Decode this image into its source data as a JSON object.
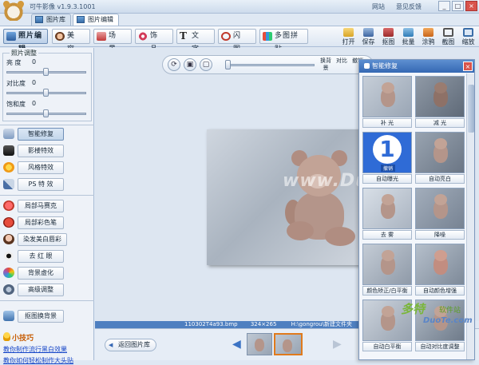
{
  "app": {
    "title": "可牛影像 v1.9.3.1001"
  },
  "top_links": [
    "网站",
    "意见反馈"
  ],
  "window_buttons": [
    "_",
    "□",
    "×"
  ],
  "tabs": [
    {
      "label": "图片库",
      "active": false
    },
    {
      "label": "图片编辑",
      "active": true
    }
  ],
  "modes": [
    {
      "label": "照片编辑",
      "icon": "photo-edit-icon",
      "active": true
    },
    {
      "label": "美 容",
      "icon": "beauty-icon",
      "active": false
    },
    {
      "label": "场 景",
      "icon": "scene-icon",
      "active": false
    },
    {
      "label": "饰 品",
      "icon": "accessory-icon",
      "active": false
    },
    {
      "label": "文 字",
      "icon": "text-icon",
      "active": false
    },
    {
      "label": "闪 图",
      "icon": "flash-icon",
      "active": false
    },
    {
      "label": "多图拼贴",
      "icon": "collage-icon",
      "active": false
    }
  ],
  "right_tools": [
    "打开",
    "保存",
    "抠图",
    "批量",
    "涂鸦",
    "截图",
    "缩放"
  ],
  "adjust": {
    "title": "照片调整",
    "rows": [
      {
        "label": "亮 度",
        "value": "0"
      },
      {
        "label": "对比度",
        "value": "0"
      },
      {
        "label": "饱和度",
        "value": "0"
      }
    ]
  },
  "functions": [
    {
      "label": "智能修复",
      "icon": "smart-repair-icon",
      "active": true
    },
    {
      "label": "影楼特效",
      "icon": "studio-effect-icon",
      "active": false
    },
    {
      "label": "风格特效",
      "icon": "style-effect-icon",
      "active": false
    },
    {
      "label": "PS 特 效",
      "icon": "ps-effect-icon",
      "active": false
    },
    {
      "label": "局部马赛克",
      "icon": "mosaic-icon",
      "active": false
    },
    {
      "label": "局部彩色笔",
      "icon": "color-pen-icon",
      "active": false
    },
    {
      "label": "染发美白唇彩",
      "icon": "makeup-icon",
      "active": false
    },
    {
      "label": "去 红 眼",
      "icon": "red-eye-icon",
      "active": false
    },
    {
      "label": "背景虚化",
      "icon": "blur-bg-icon",
      "active": false
    },
    {
      "label": "高级调整",
      "icon": "advanced-icon",
      "active": false
    },
    {
      "label": "抠图换背景",
      "icon": "cutout-icon",
      "active": false
    }
  ],
  "tips": {
    "title": "小技巧",
    "links": [
      "教你制作流行黑白效果",
      "教你如何轻松制作大头贴"
    ]
  },
  "view_tools": [
    {
      "label": "换背景"
    },
    {
      "label": "对比"
    },
    {
      "label": "撤销"
    }
  ],
  "zoom_fraction": 0.05,
  "watermark": "www.DuoTe.com",
  "status": {
    "file": "110302T4a93.bmp",
    "size": "324×265",
    "path": "H:\\gongrou\\新建文件夹"
  },
  "bottom": {
    "back_label": "返回图片库"
  },
  "smart_panel": {
    "title": "智能修复",
    "items": [
      {
        "label": "补 光",
        "active": false
      },
      {
        "label": "减 光",
        "active": false
      },
      {
        "label": "自动曝光",
        "active": true,
        "number": "1",
        "undo": "撤销"
      },
      {
        "label": "自动亮白",
        "active": false
      },
      {
        "label": "去 雾",
        "active": false
      },
      {
        "label": "降噪",
        "active": false
      },
      {
        "label": "颜色矫正/白平衡",
        "active": false
      },
      {
        "label": "自动颜色增强",
        "active": false
      },
      {
        "label": "自动白平衡",
        "active": false
      },
      {
        "label": "自动对比度调整",
        "active": false
      }
    ]
  },
  "brand": {
    "name": "多特",
    "sub": "软件站",
    "url": "DuoTe.com"
  }
}
